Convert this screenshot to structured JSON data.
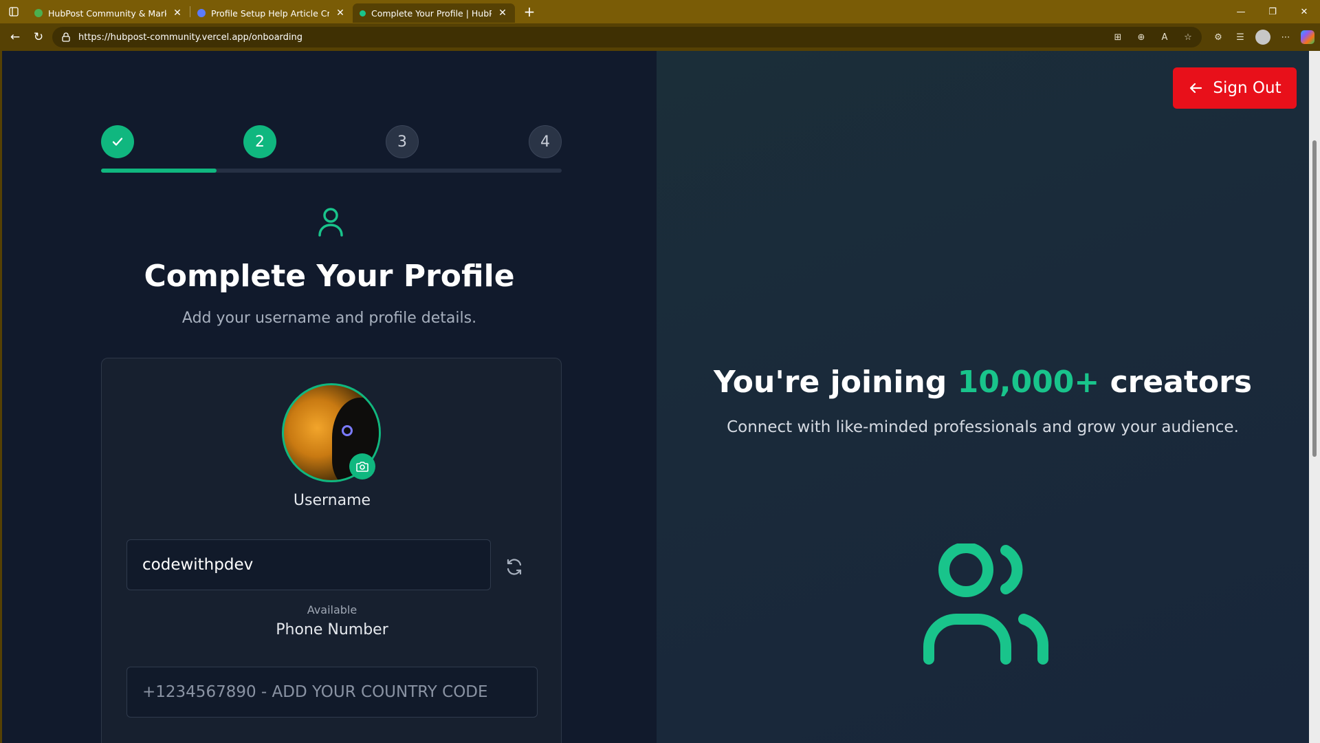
{
  "browser": {
    "tabs": [
      {
        "title": "HubPost Community & Marketpl",
        "active": false,
        "favicon_color": "#4caf50"
      },
      {
        "title": "Profile Setup Help Article Creatio",
        "active": false,
        "favicon_color": "#5b7cff"
      },
      {
        "title": "Complete Your Profile | HubPost (",
        "active": true,
        "favicon_color": "#19c48b"
      }
    ],
    "url": "https://hubpost-community.vercel.app/onboarding",
    "accent_color": "#7a5c06"
  },
  "stepper": {
    "steps": [
      {
        "label": "",
        "state": "done",
        "icon": "check-icon"
      },
      {
        "label": "2",
        "state": "current"
      },
      {
        "label": "3",
        "state": "pending"
      },
      {
        "label": "4",
        "state": "pending"
      }
    ],
    "progress": 0.25
  },
  "onboarding": {
    "title": "Complete Your Profile",
    "subtitle": "Add your username and profile details.",
    "username_label": "Username",
    "username_value": "codewithpdev",
    "username_status": "Available",
    "phone_label": "Phone Number",
    "phone_placeholder": "+1234567890 - ADD YOUR COUNTRY CODE"
  },
  "promo": {
    "signout_label": "Sign Out",
    "headline_before": "You're joining ",
    "headline_accent": "10,000+",
    "headline_after": " creators",
    "tagline": "Connect with like-minded professionals and grow your audience."
  },
  "colors": {
    "brand_green": "#10b77f",
    "danger_red": "#e8101a"
  }
}
